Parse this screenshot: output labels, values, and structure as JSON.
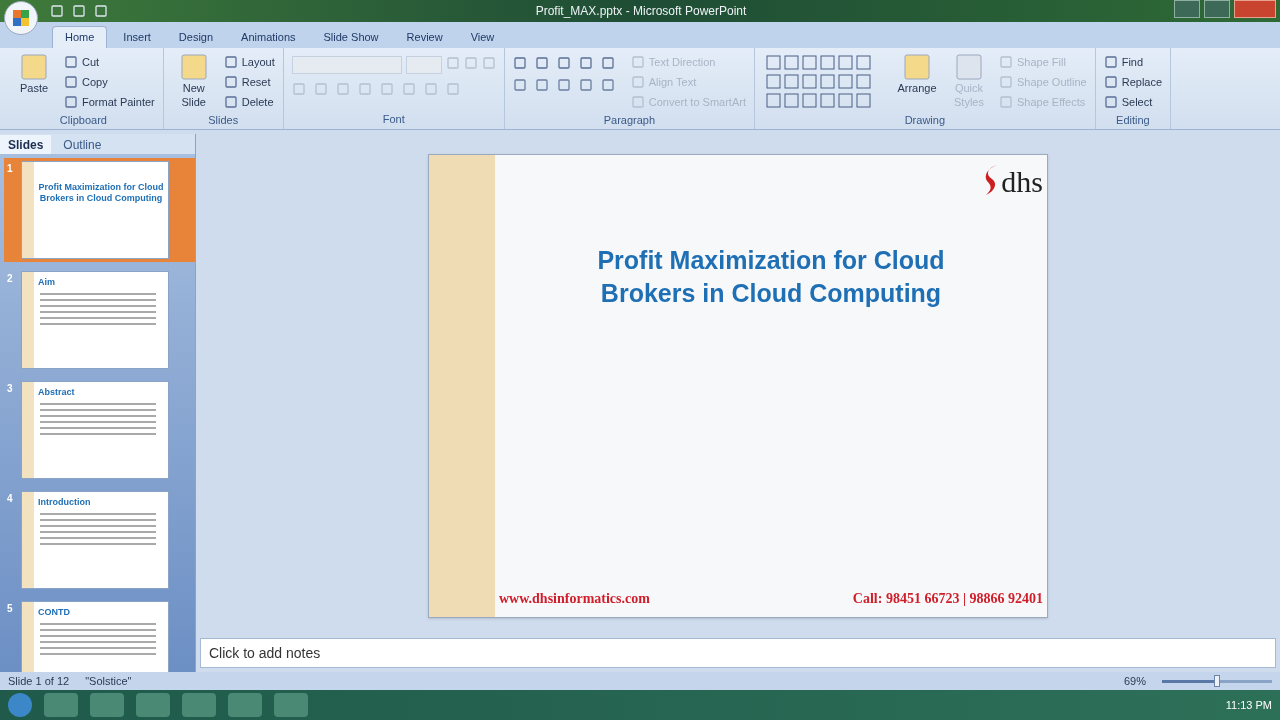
{
  "window": {
    "title": "Profit_MAX.pptx - Microsoft PowerPoint"
  },
  "tabs": [
    {
      "label": "Home",
      "selected": true
    },
    {
      "label": "Insert",
      "selected": false
    },
    {
      "label": "Design",
      "selected": false
    },
    {
      "label": "Animations",
      "selected": false
    },
    {
      "label": "Slide Show",
      "selected": false
    },
    {
      "label": "Review",
      "selected": false
    },
    {
      "label": "View",
      "selected": false
    }
  ],
  "ribbon": {
    "groups": [
      {
        "label": "Clipboard",
        "items": [
          {
            "kind": "large",
            "label": "Paste",
            "disabled": false
          },
          {
            "kind": "small",
            "label": "Cut",
            "disabled": false
          },
          {
            "kind": "small",
            "label": "Copy",
            "disabled": false
          },
          {
            "kind": "small",
            "label": "Format Painter",
            "disabled": false
          }
        ]
      },
      {
        "label": "Slides",
        "items": [
          {
            "kind": "large",
            "label": "New Slide",
            "disabled": false
          },
          {
            "kind": "small",
            "label": "Layout",
            "disabled": false
          },
          {
            "kind": "small",
            "label": "Reset",
            "disabled": false
          },
          {
            "kind": "small",
            "label": "Delete",
            "disabled": false
          }
        ]
      },
      {
        "label": "Font",
        "items": [
          {
            "kind": "font",
            "disabled": true
          }
        ]
      },
      {
        "label": "Paragraph",
        "items": [
          {
            "kind": "para"
          },
          {
            "kind": "small",
            "label": "Text Direction",
            "disabled": true
          },
          {
            "kind": "small",
            "label": "Align Text",
            "disabled": true
          },
          {
            "kind": "small",
            "label": "Convert to SmartArt",
            "disabled": true
          }
        ]
      },
      {
        "label": "Drawing",
        "items": [
          {
            "kind": "shapes"
          },
          {
            "kind": "large",
            "label": "Arrange",
            "disabled": false
          },
          {
            "kind": "large",
            "label": "Quick Styles",
            "disabled": true
          },
          {
            "kind": "small",
            "label": "Shape Fill",
            "disabled": true
          },
          {
            "kind": "small",
            "label": "Shape Outline",
            "disabled": true
          },
          {
            "kind": "small",
            "label": "Shape Effects",
            "disabled": true
          }
        ]
      },
      {
        "label": "Editing",
        "items": [
          {
            "kind": "small",
            "label": "Find",
            "disabled": false
          },
          {
            "kind": "small",
            "label": "Replace",
            "disabled": false
          },
          {
            "kind": "small",
            "label": "Select",
            "disabled": false
          }
        ]
      }
    ]
  },
  "panel_tabs": [
    {
      "label": "Slides",
      "selected": true
    },
    {
      "label": "Outline",
      "selected": false
    }
  ],
  "thumbnails": [
    {
      "number": "1",
      "title": "Profit Maximization for Cloud Brokers in Cloud Computing",
      "selected": true,
      "kind": "title"
    },
    {
      "number": "2",
      "title": "Aim",
      "selected": false,
      "kind": "content"
    },
    {
      "number": "3",
      "title": "Abstract",
      "selected": false,
      "kind": "content"
    },
    {
      "number": "4",
      "title": "Introduction",
      "selected": false,
      "kind": "content"
    },
    {
      "number": "5",
      "title": "CONTD",
      "selected": false,
      "kind": "content"
    }
  ],
  "slide": {
    "logo": "dhs",
    "title": "Profit Maximization for Cloud Brokers in Cloud Computing",
    "website": "www.dhsinformatics.com",
    "phone": "Call: 98451 66723 | 98866 92401"
  },
  "notes": {
    "placeholder": "Click to add notes"
  },
  "status_bar": {
    "slide": "Slide 1 of 12",
    "theme": "\"Solstice\"",
    "zoom": "69%",
    "zoom_slider": {
      "level": 0.5
    }
  },
  "taskbar": {
    "time": "11:13 PM"
  }
}
